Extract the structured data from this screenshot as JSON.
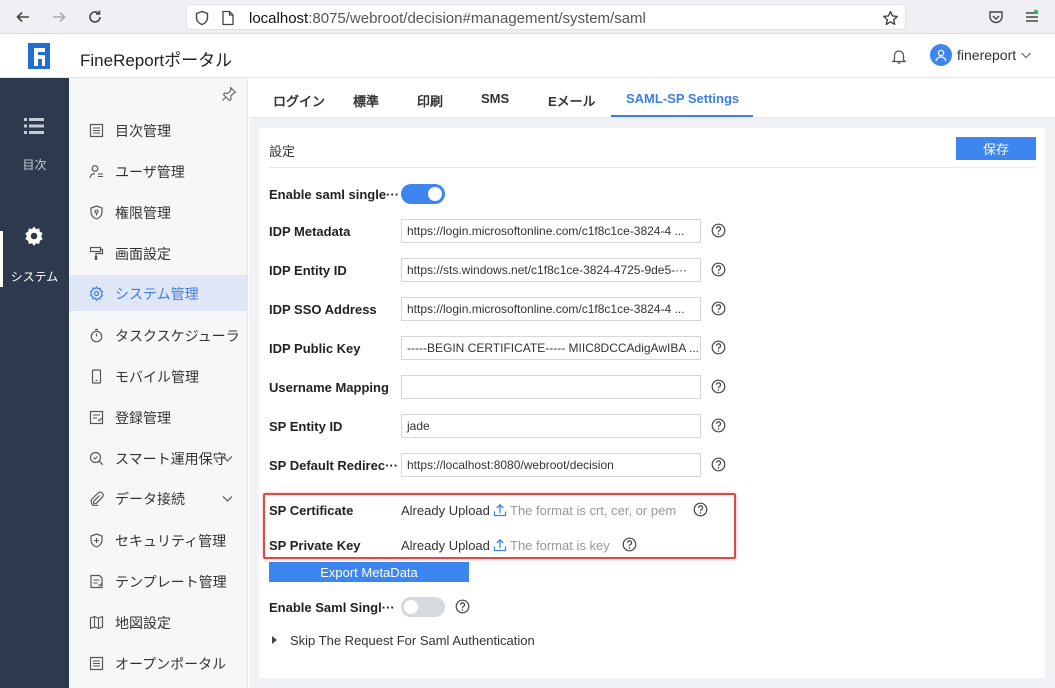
{
  "browser": {
    "url_host": "localhost",
    "url_rest": ":8075/webroot/decision#management/system/saml"
  },
  "app": {
    "title": "FineReportポータル",
    "user": "finereport"
  },
  "rail": {
    "items": [
      {
        "label": "目次",
        "icon": "list-icon"
      },
      {
        "label": "システム",
        "icon": "gear-icon"
      }
    ]
  },
  "sidebar": {
    "items": [
      {
        "label": "目次管理",
        "icon": "directory-icon"
      },
      {
        "label": "ユーザ管理",
        "icon": "user-icon"
      },
      {
        "label": "権限管理",
        "icon": "shield-icon"
      },
      {
        "label": "画面設定",
        "icon": "paint-roller-icon"
      },
      {
        "label": "システム管理",
        "icon": "gear-icon"
      },
      {
        "label": "タスクスケジューラ",
        "icon": "stopwatch-icon"
      },
      {
        "label": "モバイル管理",
        "icon": "mobile-icon"
      },
      {
        "label": "登録管理",
        "icon": "register-icon"
      },
      {
        "label": "スマート運用保守",
        "icon": "magnifier-icon"
      },
      {
        "label": "データ接続",
        "icon": "paperclip-icon"
      },
      {
        "label": "セキュリティ管理",
        "icon": "security-icon"
      },
      {
        "label": "テンプレート管理",
        "icon": "template-icon"
      },
      {
        "label": "地図設定",
        "icon": "map-icon"
      },
      {
        "label": "オープンポータル",
        "icon": "portal-icon"
      }
    ]
  },
  "tabs": [
    {
      "label": "ログイン"
    },
    {
      "label": "標準"
    },
    {
      "label": "印刷"
    },
    {
      "label": "SMS"
    },
    {
      "label": "Eメール"
    },
    {
      "label": "SAML-SP Settings"
    }
  ],
  "settings": {
    "section_title": "設定",
    "save_label": "保存",
    "enable_sso_label": "Enable saml single···",
    "enable_sso_on": true,
    "fields": [
      {
        "label": "IDP Metadata",
        "value": "https://login.microsoftonline.com/c1f8c1ce-3824-4 ..."
      },
      {
        "label": "IDP Entity ID",
        "value": "https://sts.windows.net/c1f8c1ce-3824-4725-9de5-···"
      },
      {
        "label": "IDP SSO Address",
        "value": "https://login.microsoftonline.com/c1f8c1ce-3824-4 ..."
      },
      {
        "label": "IDP Public Key",
        "value": "-----BEGIN CERTIFICATE----- MIIC8DCCAdigAwIBA ..."
      },
      {
        "label": "Username Mapping",
        "value": ""
      },
      {
        "label": "SP Entity ID",
        "value": "jade"
      },
      {
        "label": "SP Default Redirec···",
        "value": "https://localhost:8080/webroot/decision"
      }
    ],
    "sp_certificate": {
      "label": "SP Certificate",
      "status": "Already Upload",
      "hint": "The format is crt, cer, or pem"
    },
    "sp_private_key": {
      "label": "SP Private Key",
      "status": "Already Upload",
      "hint": "The format is key"
    },
    "export_label": "Export MetaData",
    "enable_slo_label": "Enable Saml Singl···",
    "enable_slo_on": false,
    "skip_label": "Skip The Request For Saml Authentication"
  }
}
